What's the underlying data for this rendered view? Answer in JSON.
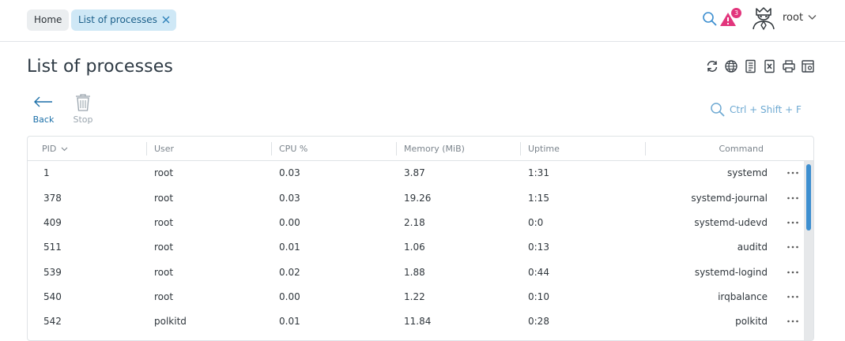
{
  "breadcrumbs": [
    {
      "label": "Home"
    },
    {
      "label": "List of processes"
    }
  ],
  "header": {
    "alert_count": "3",
    "user_name": "root"
  },
  "page": {
    "title": "List of processes"
  },
  "toolbar": {
    "back_label": "Back",
    "stop_label": "Stop",
    "search_hint": "Ctrl + Shift + F"
  },
  "table": {
    "columns": [
      "PID",
      "User",
      "CPU %",
      "Memory (MiB)",
      "Uptime",
      "Command"
    ],
    "rows": [
      {
        "pid": "1",
        "user": "root",
        "cpu": "0.03",
        "memory": "3.87",
        "uptime": "1:31",
        "command": "systemd"
      },
      {
        "pid": "378",
        "user": "root",
        "cpu": "0.03",
        "memory": "19.26",
        "uptime": "1:15",
        "command": "systemd-journal"
      },
      {
        "pid": "409",
        "user": "root",
        "cpu": "0.00",
        "memory": "2.18",
        "uptime": "0:0",
        "command": "systemd-udevd"
      },
      {
        "pid": "511",
        "user": "root",
        "cpu": "0.01",
        "memory": "1.06",
        "uptime": "0:13",
        "command": "auditd"
      },
      {
        "pid": "539",
        "user": "root",
        "cpu": "0.02",
        "memory": "1.88",
        "uptime": "0:44",
        "command": "systemd-logind"
      },
      {
        "pid": "540",
        "user": "root",
        "cpu": "0.00",
        "memory": "1.22",
        "uptime": "0:10",
        "command": "irqbalance"
      },
      {
        "pid": "542",
        "user": "polkitd",
        "cpu": "0.01",
        "memory": "11.84",
        "uptime": "0:28",
        "command": "polkitd"
      }
    ]
  },
  "icons": {
    "search": "search-icon",
    "alert": "alert-triangle-icon",
    "user": "user-avatar-icon",
    "refresh": "refresh-icon",
    "globe": "globe-icon",
    "script": "script-icon",
    "excel": "excel-export-icon",
    "print": "print-icon",
    "settings": "table-settings-icon",
    "back": "arrow-left-icon",
    "stop": "trash-icon",
    "row_menu": "more-dots-icon"
  },
  "colors": {
    "accent": "#3d8fd0",
    "alert": "#e2357c",
    "breadcrumb_active_bg": "#cfe8f6"
  }
}
